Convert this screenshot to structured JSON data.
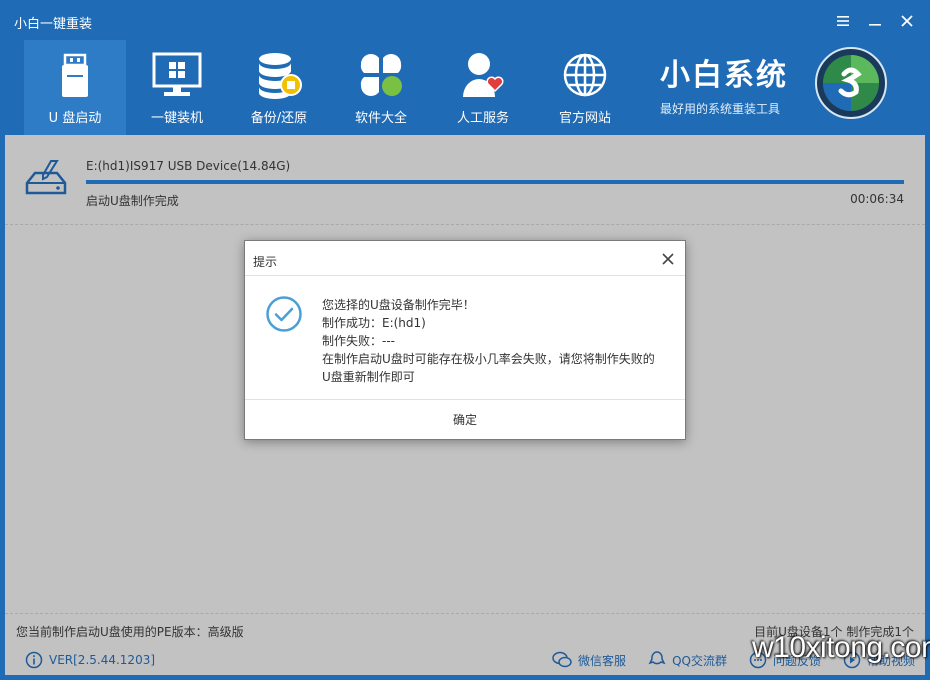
{
  "app": {
    "title": "小白一键重装"
  },
  "window_controls": {
    "menu": "menu-icon",
    "minimize": "minimize-icon",
    "close": "close-icon"
  },
  "nav": {
    "items": [
      {
        "label": "U 盘启动",
        "icon": "usb-drive-icon",
        "active": true
      },
      {
        "label": "一键装机",
        "icon": "monitor-icon",
        "active": false
      },
      {
        "label": "备份/还原",
        "icon": "database-icon",
        "active": false
      },
      {
        "label": "软件大全",
        "icon": "apps-icon",
        "active": false
      },
      {
        "label": "人工服务",
        "icon": "support-person-icon",
        "active": false
      },
      {
        "label": "官方网站",
        "icon": "globe-icon",
        "active": false
      }
    ]
  },
  "brand": {
    "title": "小白系统",
    "subtitle": "最好用的系统重装工具"
  },
  "device": {
    "name": "E:(hd1)IS917 USB Device(14.84G)",
    "progress": 1.0,
    "status": "启动U盘制作完成",
    "elapsed": "00:06:34"
  },
  "status_bar": {
    "pe_version": "您当前制作启动U盘使用的PE版本：高级版",
    "device_count": "目前U盘设备1个 制作完成1个"
  },
  "footer": {
    "version": "VER[2.5.44.1203]",
    "links": [
      {
        "label": "微信客服",
        "icon": "wechat-icon"
      },
      {
        "label": "QQ交流群",
        "icon": "qq-icon"
      },
      {
        "label": "问题反馈",
        "icon": "chat-bubble-icon"
      },
      {
        "label": "帮助视频",
        "icon": "play-icon"
      }
    ]
  },
  "dialog": {
    "title": "提示",
    "lines": [
      "您选择的U盘设备制作完毕！",
      "制作成功：E:(hd1)",
      "制作失败：---",
      "在制作启动U盘时可能存在极小几率会失败，请您将制作失败的",
      "U盘重新制作即可"
    ],
    "ok_label": "确定"
  },
  "watermark": "w10xitong.com",
  "colors": {
    "header_blue": "#1f6bb5",
    "active_tab": "#2e7bc6",
    "dim_overlay": "#c2c2c2",
    "check_blue": "#4a9fd8"
  }
}
